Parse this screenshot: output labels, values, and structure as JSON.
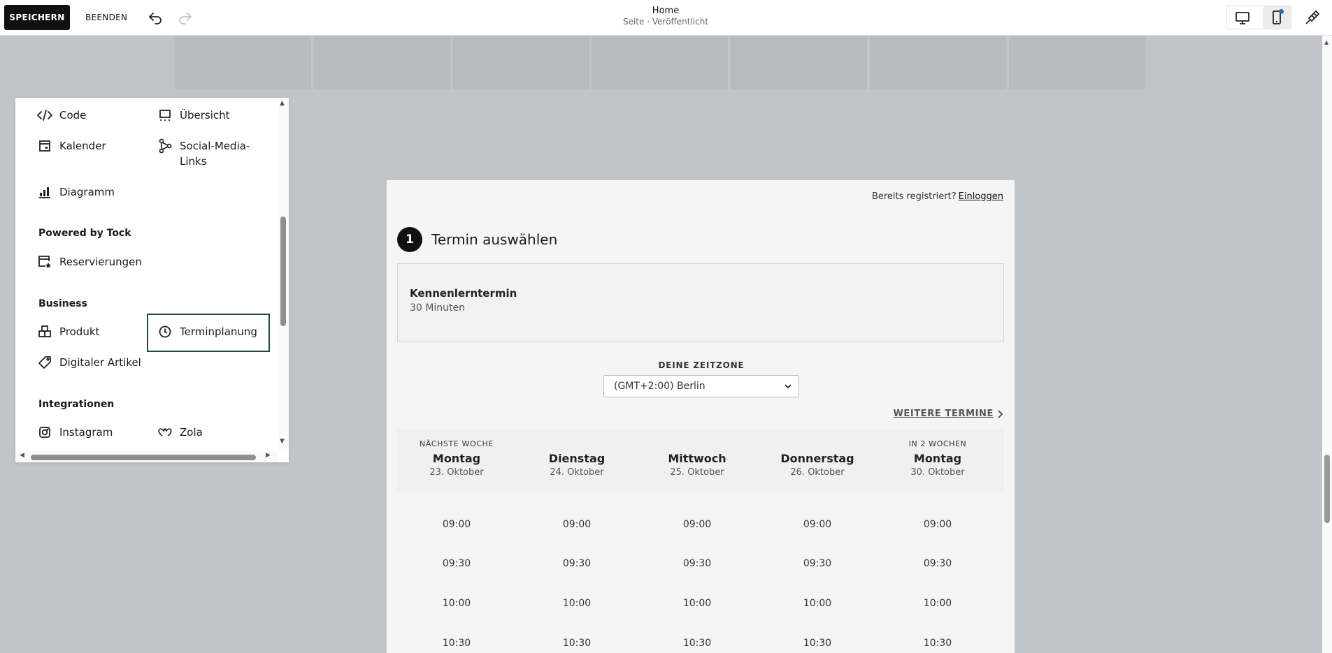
{
  "toolbar": {
    "save_label": "SPEICHERN",
    "exit_label": "BEENDEN",
    "page_title": "Home",
    "page_status": "Seite · Veröffentlicht"
  },
  "panel": {
    "items": [
      {
        "label": "Code",
        "icon": "code-icon"
      },
      {
        "label": "Übersicht",
        "icon": "summary-icon"
      },
      {
        "label": "Kalender",
        "icon": "calendar-icon"
      },
      {
        "label": "Social-Media-",
        "label2": "Links",
        "icon": "social-links-icon"
      },
      {
        "label": "Diagramm",
        "icon": "chart-icon"
      },
      {
        "label": "Reservierungen",
        "icon": "reservation-icon"
      },
      {
        "label": "Produkt",
        "icon": "product-icon"
      },
      {
        "label": "Terminplanung",
        "icon": "clock-icon"
      },
      {
        "label": "Digitaler Artikel",
        "icon": "tag-icon"
      },
      {
        "label": "Instagram",
        "icon": "instagram-icon"
      },
      {
        "label": "Zola",
        "icon": "zola-icon"
      }
    ],
    "sections": {
      "tock": "Powered by Tock",
      "business": "Business",
      "integrations": "Integrationen"
    }
  },
  "scheduler": {
    "already_registered": "Bereits registriert?",
    "login_link": "Einloggen",
    "step_number": "1",
    "step_title": "Termin auswählen",
    "appointment_name": "Kennenlerntermin",
    "appointment_duration": "30 Minuten",
    "timezone_label": "DEINE ZEITZONE",
    "timezone_value": "(GMT+2:00) Berlin",
    "more_dates": "WEITERE TERMINE",
    "days": [
      {
        "week": "NÄCHSTE WOCHE",
        "name": "Montag",
        "date": "23. Oktober"
      },
      {
        "week": "",
        "name": "Dienstag",
        "date": "24. Oktober"
      },
      {
        "week": "",
        "name": "Mittwoch",
        "date": "25. Oktober"
      },
      {
        "week": "",
        "name": "Donnerstag",
        "date": "26. Oktober"
      },
      {
        "week": "IN 2 WOCHEN",
        "name": "Montag",
        "date": "30. Oktober"
      }
    ],
    "times": [
      "09:00",
      "09:30",
      "10:00",
      "10:30"
    ]
  }
}
